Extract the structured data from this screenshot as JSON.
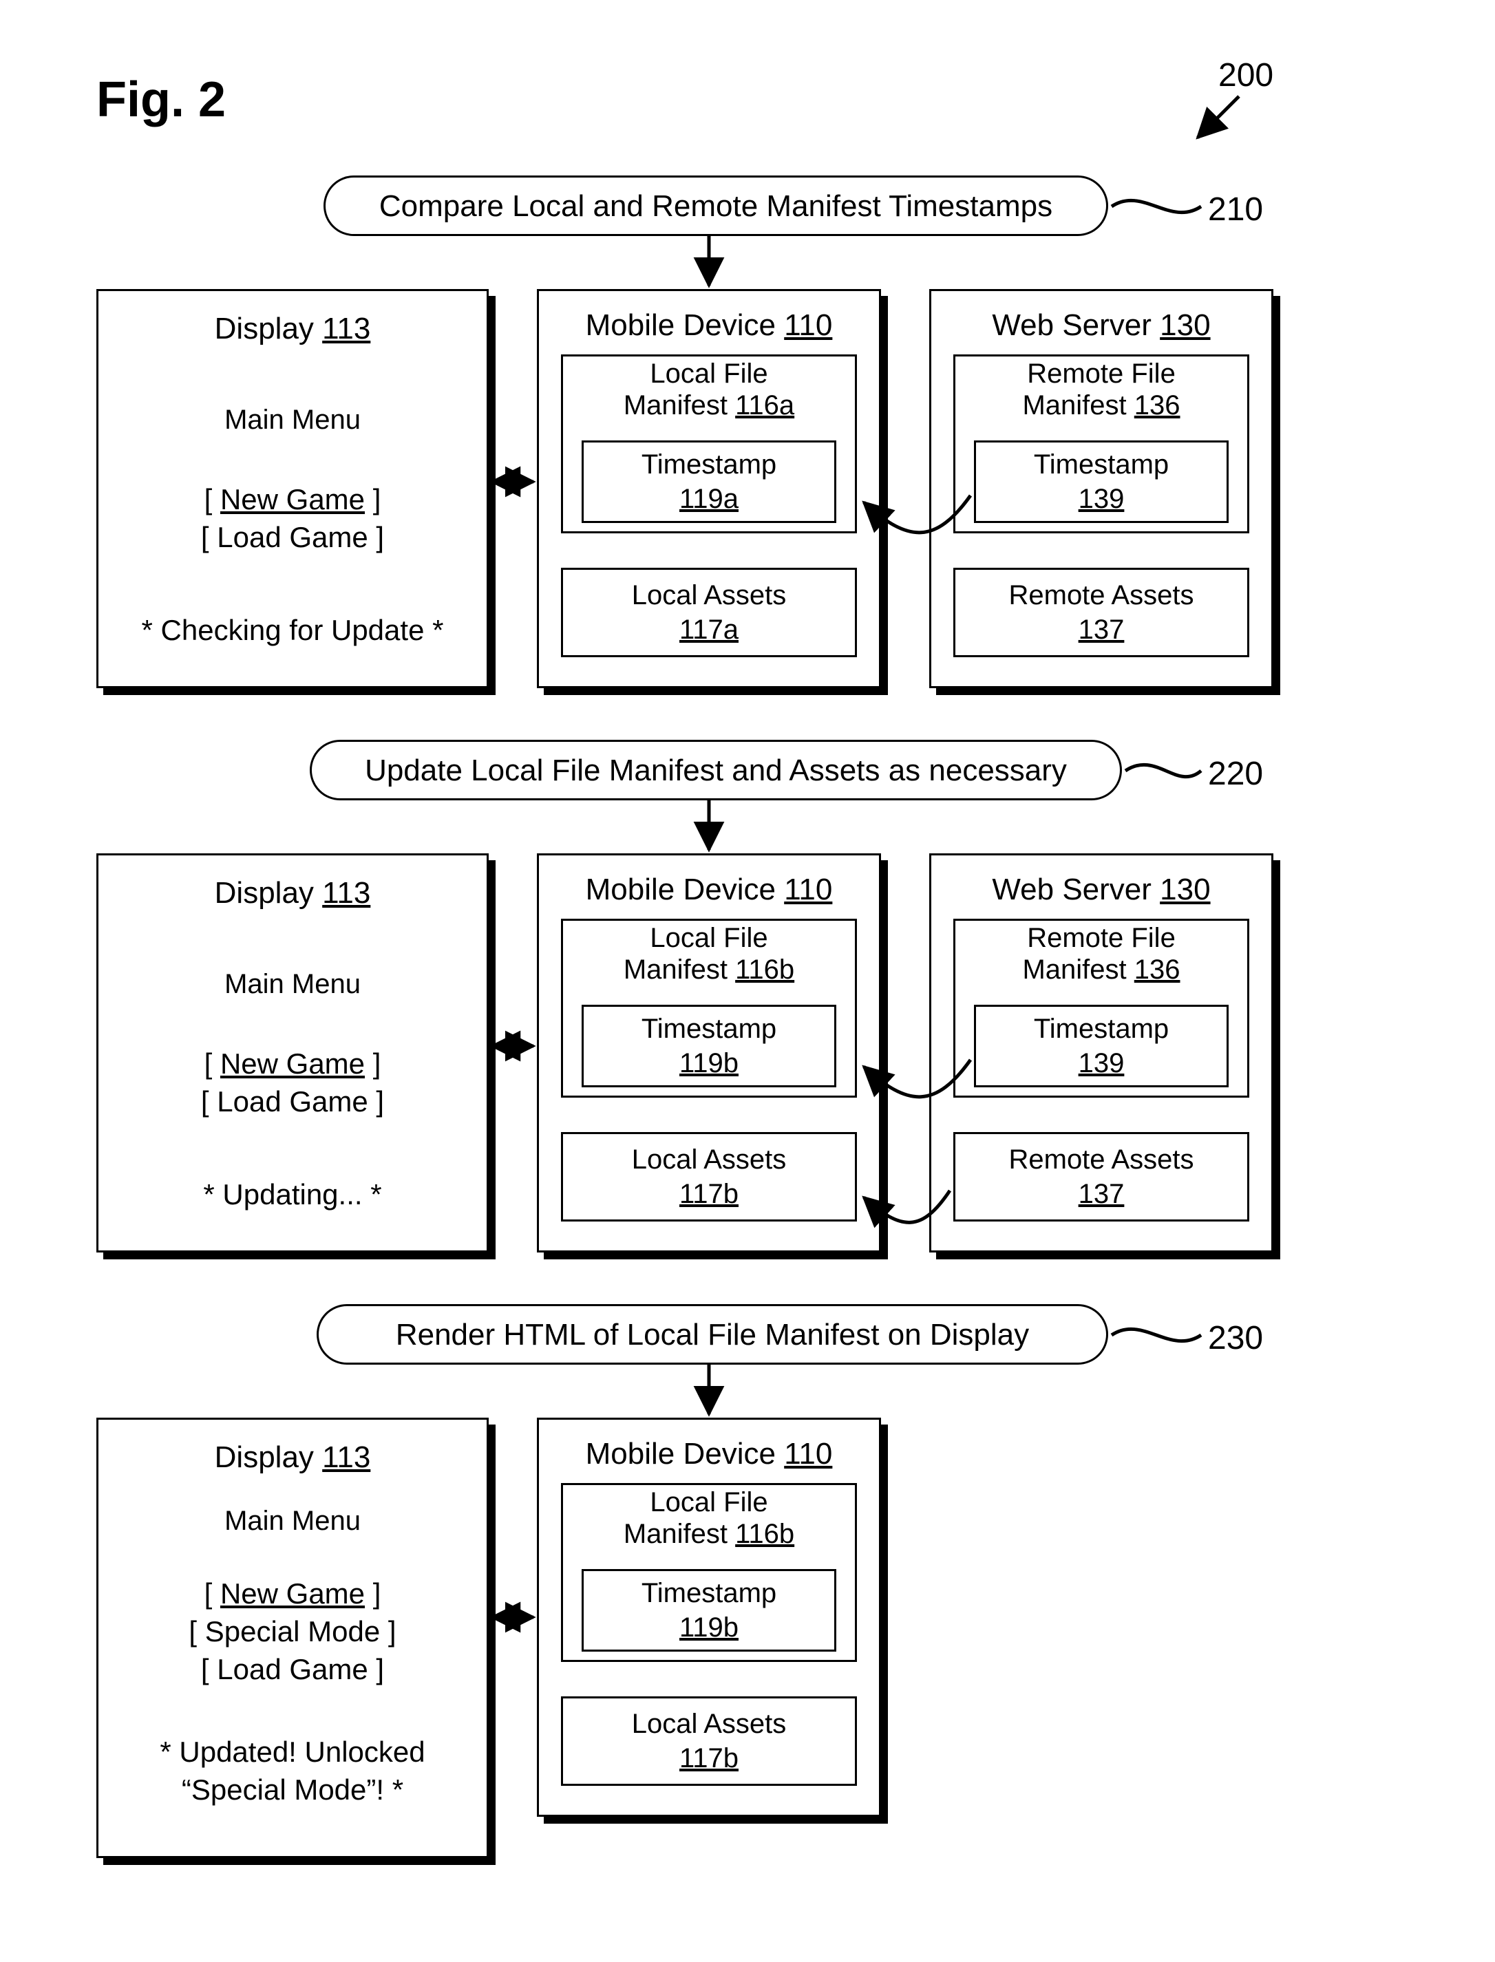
{
  "figure": {
    "label": "Fig. 2",
    "overall_ref": "200"
  },
  "steps": {
    "s210": {
      "text": "Compare Local and Remote Manifest Timestamps",
      "ref": "210"
    },
    "s220": {
      "text": "Update Local File Manifest and Assets as necessary",
      "ref": "220"
    },
    "s230": {
      "text": "Render HTML of Local File Manifest on Display",
      "ref": "230"
    }
  },
  "display": {
    "title": "Display",
    "ref": "113",
    "main_menu": "Main Menu",
    "menu_new": "[ New Game ]",
    "menu_load": "[ Load Game ]",
    "menu_special": "[ Special Mode ]",
    "status_check": "* Checking for Update *",
    "status_update": "* Updating... *",
    "status_done_l1": "* Updated! Unlocked",
    "status_done_l2": "“Special Mode”! *"
  },
  "mobile": {
    "title": "Mobile Device",
    "ref": "110",
    "manifest_label": "Local File Manifest",
    "manifest_ref_a": "116a",
    "manifest_ref_b": "116b",
    "timestamp_label": "Timestamp",
    "timestamp_ref_a": "119a",
    "timestamp_ref_b": "119b",
    "assets_label": "Local Assets",
    "assets_ref_a": "117a",
    "assets_ref_b": "117b"
  },
  "server": {
    "title": "Web Server",
    "ref": "130",
    "manifest_label": "Remote File Manifest",
    "manifest_ref": "136",
    "timestamp_label": "Timestamp",
    "timestamp_ref": "139",
    "assets_label": "Remote Assets",
    "assets_ref": "137"
  }
}
